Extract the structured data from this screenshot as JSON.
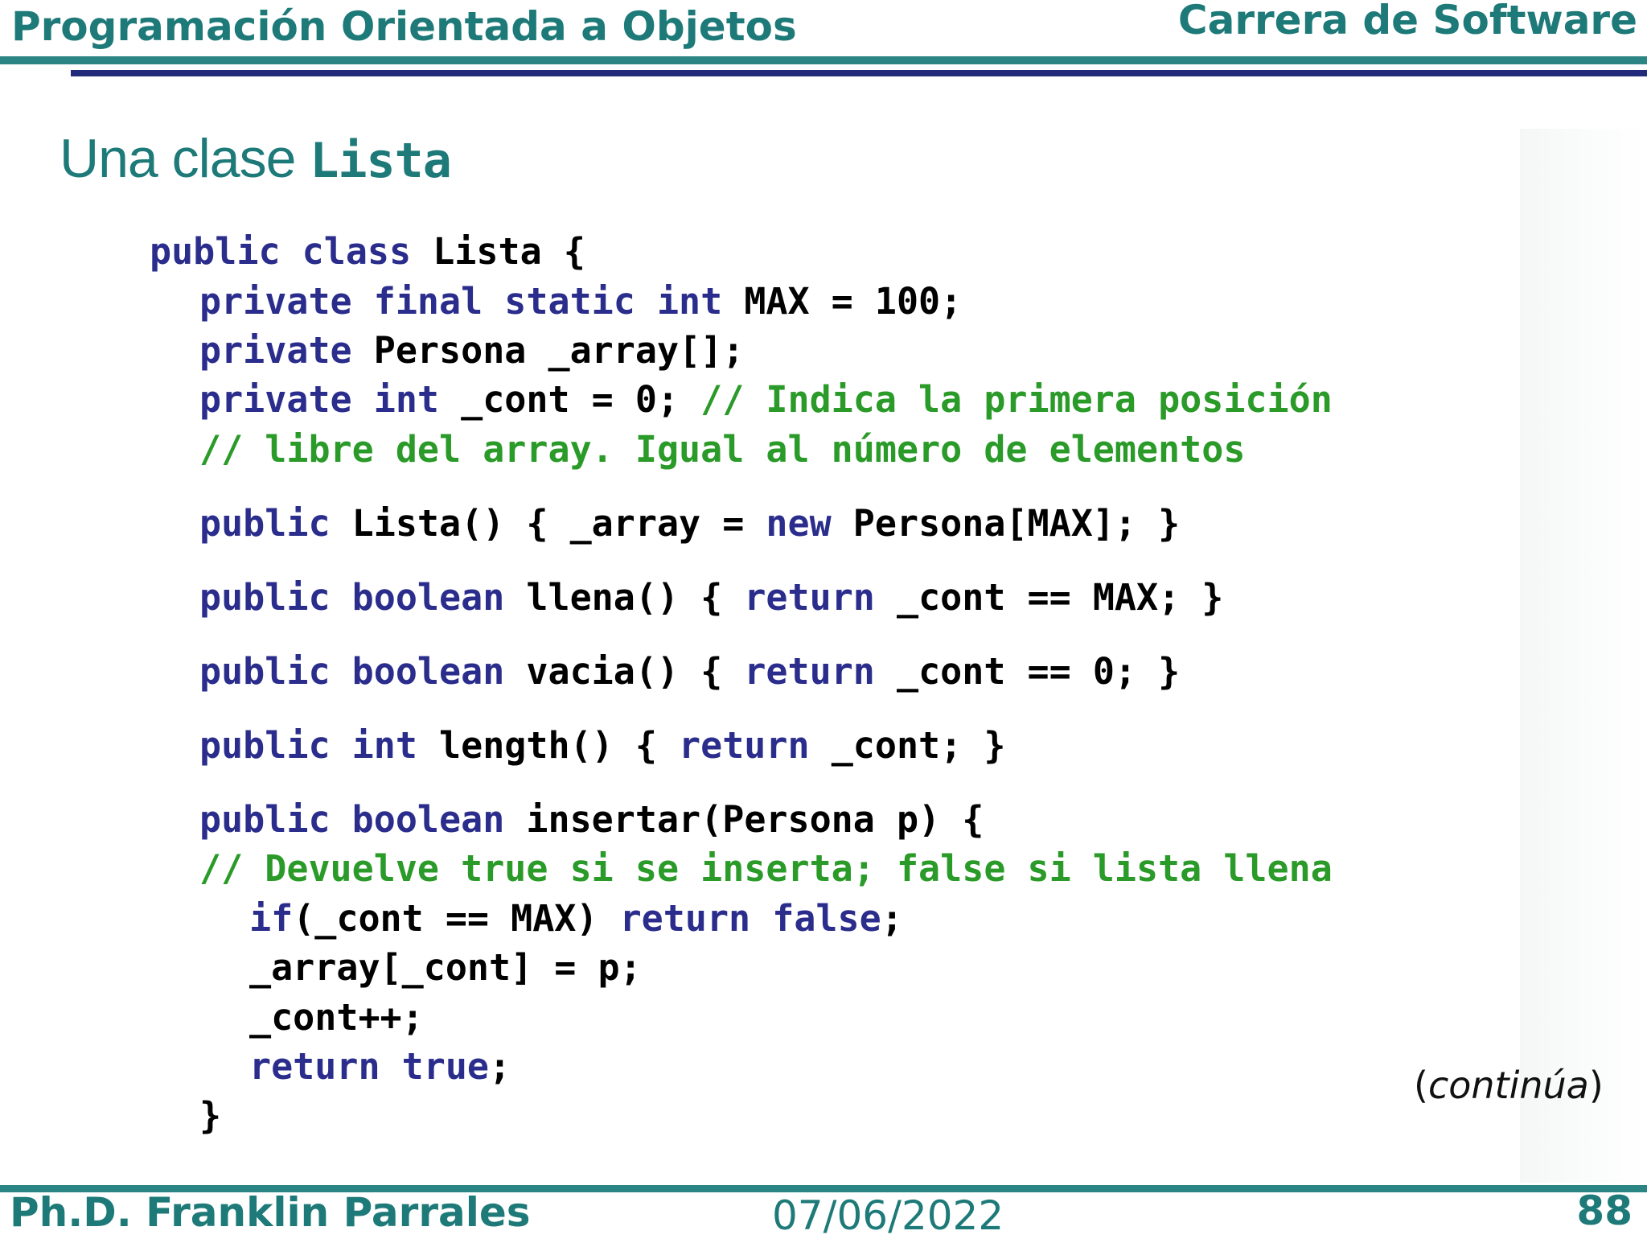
{
  "header": {
    "course_title": "Programación Orientada a Objetos",
    "program": "Carrera de Software"
  },
  "slide": {
    "title_prefix": "Una clase ",
    "title_class_name": "Lista",
    "continues_open": "(",
    "continues_word": "continúa",
    "continues_close": ")"
  },
  "code": [
    [
      [
        "kw",
        "public class "
      ],
      [
        "pl",
        "Lista {"
      ]
    ],
    [
      [
        "kw",
        "private final static int "
      ],
      [
        "pl",
        "MAX = 100;"
      ]
    ],
    [
      [
        "kw",
        "private "
      ],
      [
        "pl",
        "Persona _array[];"
      ]
    ],
    [
      [
        "kw",
        "private int "
      ],
      [
        "pl",
        "_cont = 0; "
      ],
      [
        "cm",
        "// Indica la primera posición"
      ]
    ],
    [
      [
        "cm",
        "// libre del array. Igual al número de elementos"
      ]
    ],
    [
      [
        "kw",
        "public "
      ],
      [
        "pl",
        "Lista() { _array = "
      ],
      [
        "kw",
        "new "
      ],
      [
        "pl",
        "Persona[MAX]; }"
      ]
    ],
    [
      [
        "kw",
        "public boolean "
      ],
      [
        "pl",
        "llena() { "
      ],
      [
        "kw",
        "return "
      ],
      [
        "pl",
        "_cont == MAX; }"
      ]
    ],
    [
      [
        "kw",
        "public boolean "
      ],
      [
        "pl",
        "vacia() { "
      ],
      [
        "kw",
        "return "
      ],
      [
        "pl",
        "_cont == 0; }"
      ]
    ],
    [
      [
        "kw",
        "public int "
      ],
      [
        "pl",
        "length() { "
      ],
      [
        "kw",
        "return "
      ],
      [
        "pl",
        "_cont; }"
      ]
    ],
    [
      [
        "kw",
        "public boolean "
      ],
      [
        "pl",
        "insertar(Persona p) {"
      ]
    ],
    [
      [
        "cm",
        "// Devuelve true si se inserta; false si lista llena"
      ]
    ],
    [
      [
        "kw",
        "if"
      ],
      [
        "pl",
        "(_cont == MAX) "
      ],
      [
        "kw",
        "return false"
      ],
      [
        "pl",
        ";"
      ]
    ],
    [
      [
        "pl",
        "_array[_cont] = p;"
      ]
    ],
    [
      [
        "pl",
        "_cont++;"
      ]
    ],
    [
      [
        "kw",
        "return true"
      ],
      [
        "pl",
        ";"
      ]
    ],
    [
      [
        "pl",
        "}"
      ]
    ]
  ],
  "footer": {
    "author": "Ph.D. Franklin Parrales",
    "date": "07/06/2022",
    "page_number": "88"
  },
  "colors": {
    "teal": "#1e7a78",
    "navy_rule": "#222a7a",
    "keyword": "#2b2d8c",
    "comment": "#2a9a28"
  }
}
